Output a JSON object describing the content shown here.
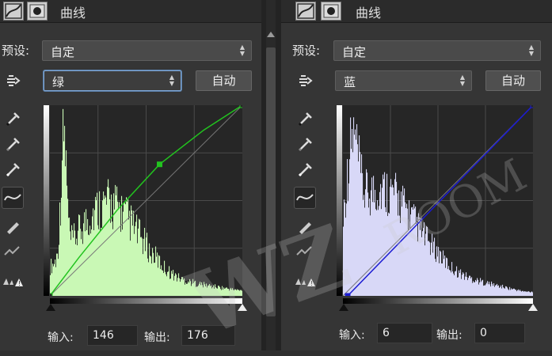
{
  "colors": {
    "left_curve": "#22c31f",
    "left_hist": "#c9f8b5",
    "right_curve": "#1a1ad2",
    "right_hist": "#d8d8f7"
  },
  "left": {
    "title": "曲线",
    "preset_label": "预设:",
    "preset_value": "自定",
    "channel_value": "绿",
    "auto_label": "自动",
    "input_label": "输入:",
    "input_value": "146",
    "output_label": "输出:",
    "output_value": "176"
  },
  "right": {
    "title": "曲线",
    "preset_label": "预设:",
    "preset_value": "自定",
    "channel_value": "蓝",
    "auto_label": "自动",
    "input_label": "输入:",
    "input_value": "6",
    "output_label": "输出:",
    "output_value": "0"
  },
  "icons": [
    "curves-adjustment-icon",
    "mask-icon",
    "target-adjust-hand-icon",
    "black-point-eyedropper-icon",
    "gray-point-eyedropper-icon",
    "white-point-eyedropper-icon",
    "curve-point-edit-icon",
    "pencil-draw-icon",
    "smooth-curve-icon",
    "clipping-warning-icon"
  ]
}
